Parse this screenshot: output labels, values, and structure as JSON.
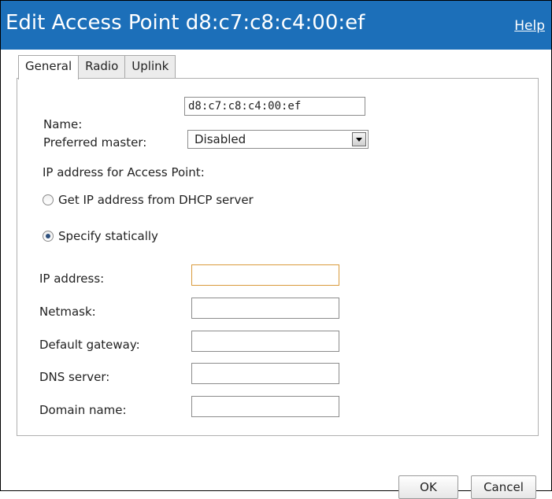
{
  "dialog": {
    "title": "Edit Access Point d8:c7:c8:c4:00:ef",
    "help_label": "Help",
    "colors": {
      "titlebar": "#1c6fb9",
      "title_text": "#ffffff"
    }
  },
  "tabs": [
    {
      "label": "General",
      "active": true
    },
    {
      "label": "Radio",
      "active": false
    },
    {
      "label": "Uplink",
      "active": false
    }
  ],
  "general": {
    "name_label": "Name:",
    "name_value": "d8:c7:c8:c4:00:ef",
    "preferred_master_label": "Preferred master:",
    "preferred_master_value": "Disabled",
    "ip_section_label": "IP address for Access Point:",
    "radio_dhcp_label": "Get IP address from DHCP server",
    "radio_static_label": "Specify statically",
    "selected_mode": "static",
    "fields": {
      "ip_address": {
        "label": "IP address:",
        "value": ""
      },
      "netmask": {
        "label": "Netmask:",
        "value": ""
      },
      "default_gateway": {
        "label": "Default gateway:",
        "value": ""
      },
      "dns_server": {
        "label": "DNS server:",
        "value": ""
      },
      "domain_name": {
        "label": "Domain name:",
        "value": ""
      }
    }
  },
  "buttons": {
    "ok": "OK",
    "cancel": "Cancel"
  }
}
